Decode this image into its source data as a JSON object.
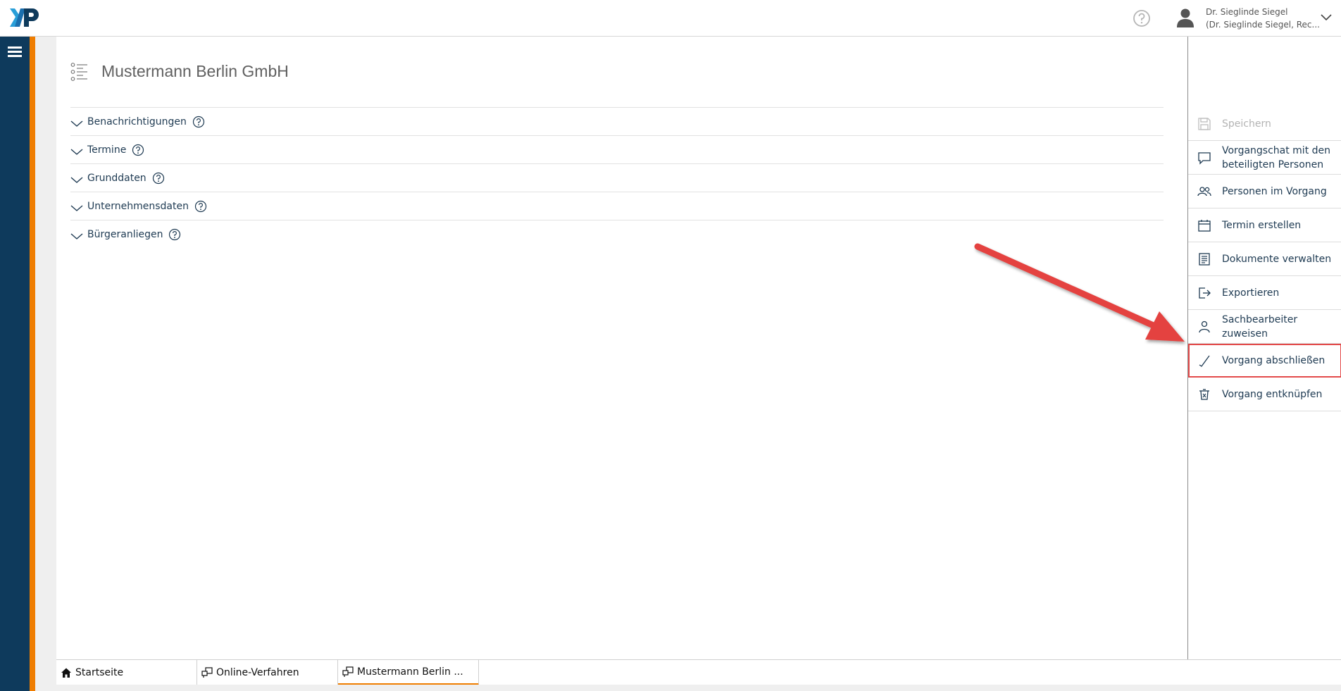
{
  "header": {
    "logo_text": "XP",
    "user_name": "Dr. Sieglinde Siegel",
    "user_sub": "(Dr. Sieglinde Siegel, Rec..."
  },
  "main": {
    "title": "Mustermann Berlin GmbH",
    "sections": [
      {
        "label": "Benachrichtigungen"
      },
      {
        "label": "Termine"
      },
      {
        "label": "Grunddaten"
      },
      {
        "label": "Unternehmensdaten"
      },
      {
        "label": "Bürgeranliegen"
      }
    ]
  },
  "actions": {
    "save": "Speichern",
    "chat": "Vorgangschat mit den beteiligten Personen",
    "persons": "Personen im Vorgang",
    "appointment": "Termin erstellen",
    "documents": "Dokumente verwalten",
    "export": "Exportieren",
    "assign": "Sachbearbeiter zuweisen",
    "close": "Vorgang abschließen",
    "unlink": "Vorgang entknüpfen"
  },
  "tabs": [
    {
      "label": "Startseite"
    },
    {
      "label": "Online-Verfahren"
    },
    {
      "label": "Mustermann Berlin ..."
    }
  ],
  "colors": {
    "nav": "#0e3a5c",
    "accent": "#ef7d00",
    "highlight": "#e34a4a"
  }
}
